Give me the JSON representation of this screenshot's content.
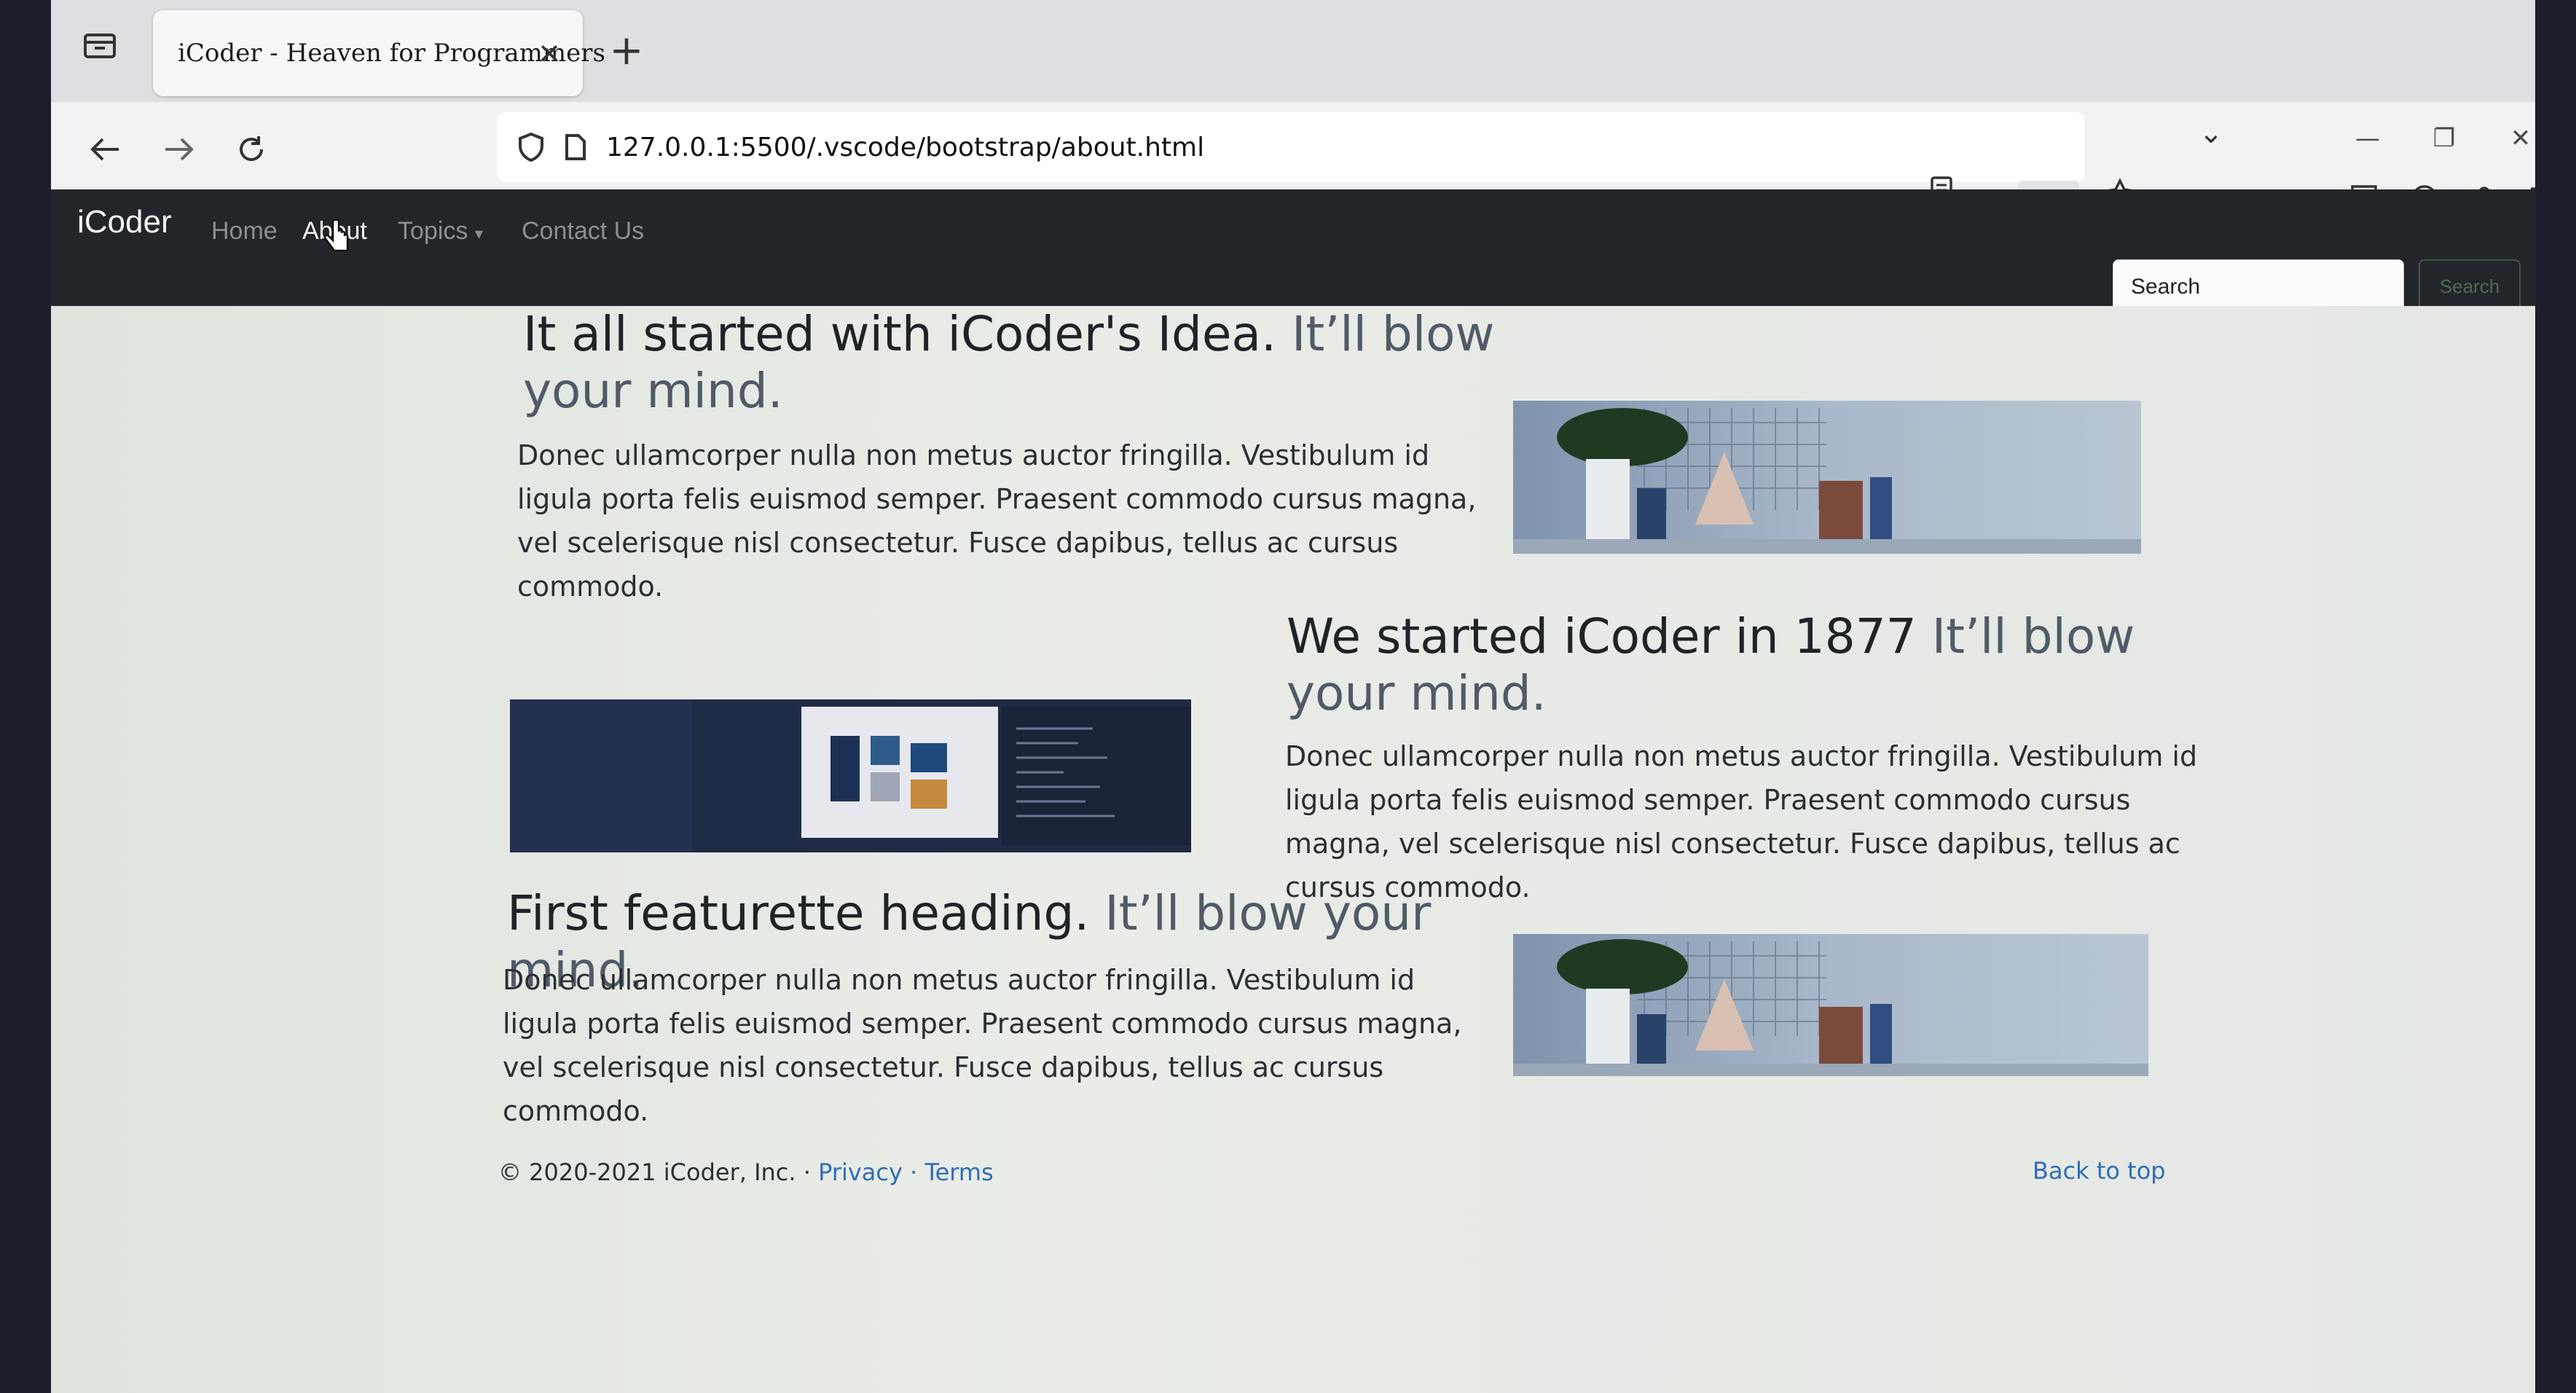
{
  "browser": {
    "tab_title": "iCoder - Heaven for Programmers",
    "url": "127.0.0.1:5500/.vscode/bootstrap/about.html",
    "zoom": "80%"
  },
  "site_nav": {
    "brand": "iCoder",
    "links": [
      "Home",
      "About",
      "Topics",
      "Contact Us"
    ],
    "active": "About",
    "search_placeholder": "Search",
    "search_button": "Search"
  },
  "features": [
    {
      "heading": "It all started with iCoder's Idea.",
      "muted": "It’ll blow your mind.",
      "text": "Donec ullamcorper nulla non metus auctor fringilla. Vestibulum id ligula porta felis euismod semper. Praesent commodo cursus magna, vel scelerisque nisl consectetur. Fusce dapibus, tellus ac cursus commodo."
    },
    {
      "heading": "We started iCoder in 1877",
      "muted": "It’ll blow your mind.",
      "text": "Donec ullamcorper nulla non metus auctor fringilla. Vestibulum id ligula porta felis euismod semper. Praesent commodo cursus magna, vel scelerisque nisl consectetur. Fusce dapibus, tellus ac cursus commodo."
    },
    {
      "heading": "First featurette heading.",
      "muted": "It’ll blow your mind.",
      "text": "Donec ullamcorper nulla non metus auctor fringilla. Vestibulum id ligula porta felis euismod semper. Praesent commodo cursus magna, vel scelerisque nisl consectetur. Fusce dapibus, tellus ac cursus commodo."
    }
  ],
  "footer": {
    "copyright": "© 2020-2021 iCoder, Inc. · ",
    "privacy": "Privacy",
    "sep": " · ",
    "terms": "Terms",
    "back_to_top": "Back to top"
  }
}
